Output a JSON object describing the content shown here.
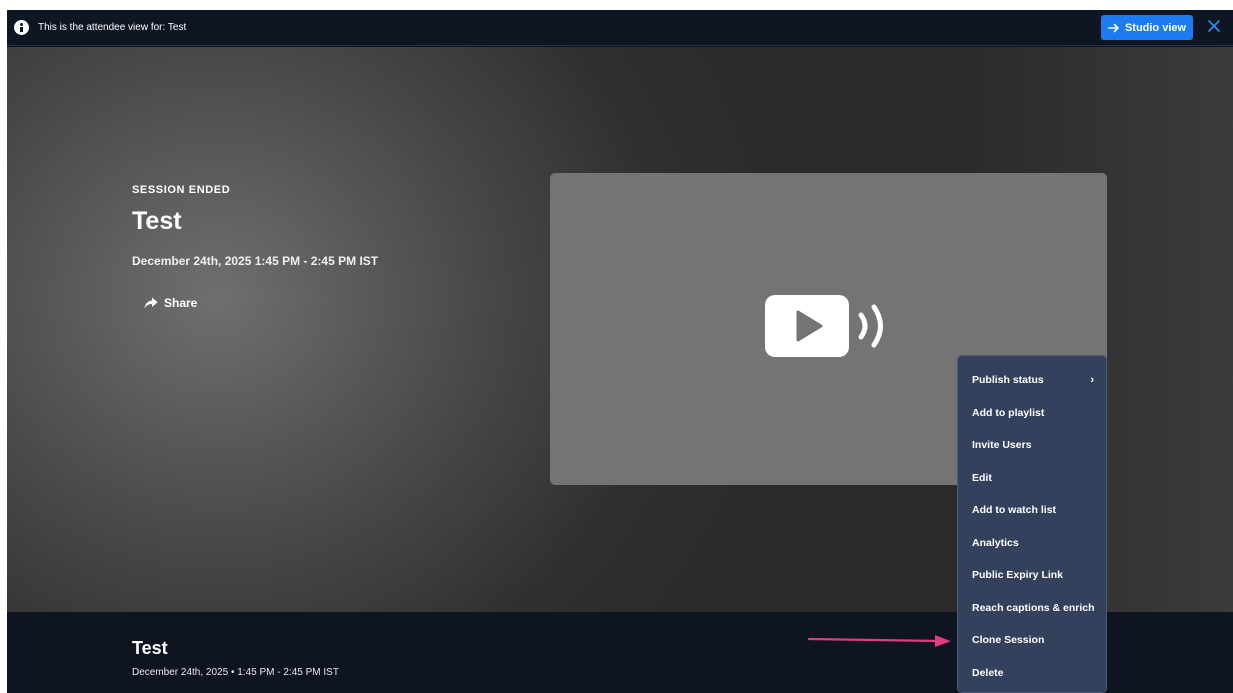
{
  "topbar": {
    "notice": "This is the attendee view for: Test",
    "studio_button": "Studio view"
  },
  "hero": {
    "status": "SESSION ENDED",
    "title": "Test",
    "datetime": "December 24th, 2025  1:45 PM - 2:45 PM IST",
    "share": "Share"
  },
  "bottom": {
    "title": "Test",
    "datetime": "December 24th, 2025  •  1:45 PM - 2:45 PM IST"
  },
  "menu": {
    "items": [
      {
        "label": "Publish status",
        "submenu": true
      },
      {
        "label": "Add to playlist"
      },
      {
        "label": "Invite Users"
      },
      {
        "label": "Edit"
      },
      {
        "label": "Add to watch list"
      },
      {
        "label": "Analytics"
      },
      {
        "label": "Public Expiry Link"
      },
      {
        "label": "Reach captions & enrich"
      },
      {
        "label": "Clone Session"
      },
      {
        "label": "Delete"
      }
    ],
    "submenu_glyph": "›"
  },
  "icons": {
    "info": "info-icon",
    "arrow": "arrow-right-icon",
    "close": "close-icon",
    "share": "share-icon",
    "player": "video-live-icon",
    "annotation": "annotation-arrow"
  },
  "colors": {
    "accent": "#1a7cf0",
    "annotation": "#e23b7e",
    "menu_bg": "#34415c"
  }
}
